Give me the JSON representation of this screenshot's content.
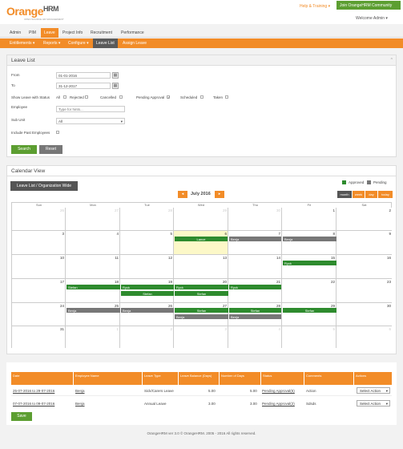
{
  "header": {
    "logo_prefix": "O",
    "logo_main": "range",
    "logo_hrm": "HRM",
    "logo_tagline": "OPEN SOURCE HR MANAGEMENT",
    "help_training": "Help & Training ▾",
    "join_community": "Join OrangeHRM Community",
    "welcome": "Welcome Admin ▾"
  },
  "main_menu": [
    "Admin",
    "PIM",
    "Leave",
    "Project Info",
    "Recruitment",
    "Performance"
  ],
  "sub_menu": [
    "Entitlements ▾",
    "Reports ▾",
    "Configure ▾",
    "Leave List",
    "Assign Leave"
  ],
  "leave_list": {
    "title": "Leave List",
    "from_label": "From",
    "from_value": "01-01-2016",
    "to_label": "To",
    "to_value": "31-12-2017",
    "status_label": "Show Leave with Status",
    "statuses": [
      {
        "label": "All",
        "checked": false
      },
      {
        "label": "Rejected",
        "checked": false
      },
      {
        "label": "Cancelled",
        "checked": false
      },
      {
        "label": "Pending Approval",
        "checked": true
      },
      {
        "label": "Scheduled",
        "checked": false
      },
      {
        "label": "Taken",
        "checked": false
      }
    ],
    "employee_label": "Employee",
    "employee_placeholder": "Type for hints...",
    "subunit_label": "Sub Unit",
    "subunit_value": "All",
    "past_label": "Include Past Employees",
    "search_btn": "Search",
    "reset_btn": "Reset"
  },
  "calendar": {
    "title": "Calendar View",
    "org_btn": "Leave List / Organization Wide",
    "legend_approved": "Approved",
    "legend_pending": "Pending",
    "month_label": "July 2016",
    "views": [
      "month",
      "week",
      "day",
      "today"
    ],
    "weekdays": [
      "Sun",
      "Mon",
      "Tue",
      "Wed",
      "Thu",
      "Fri",
      "Sat"
    ],
    "weeks": [
      [
        "26",
        "27",
        "28",
        "29",
        "30",
        "1",
        "2"
      ],
      [
        "3",
        "4",
        "5",
        "6",
        "7",
        "8",
        "9"
      ],
      [
        "10",
        "11",
        "12",
        "13",
        "14",
        "15",
        "16"
      ],
      [
        "17",
        "18",
        "19",
        "20",
        "21",
        "22",
        "23"
      ],
      [
        "24",
        "25",
        "26",
        "27",
        "28",
        "29",
        "30"
      ],
      [
        "31",
        "1",
        "2",
        "3",
        "4",
        "5",
        "6"
      ]
    ],
    "events": [
      {
        "label": "Lance",
        "color": "green"
      },
      {
        "label": "Benja",
        "color": "gray"
      },
      {
        "label": "Benja",
        "color": "gray"
      },
      {
        "label": "Ryck",
        "color": "green"
      },
      {
        "label": "Stefan",
        "color": "green"
      },
      {
        "label": "Ryck",
        "color": "green"
      },
      {
        "label": "Ryck",
        "color": "green"
      },
      {
        "label": "Ryck",
        "color": "green"
      },
      {
        "label": "Stefan",
        "color": "green"
      },
      {
        "label": "Stefan",
        "color": "green"
      },
      {
        "label": "Benja",
        "color": "gray"
      },
      {
        "label": "Benja",
        "color": "gray"
      },
      {
        "label": "Stefan",
        "color": "green"
      },
      {
        "label": "Stefan",
        "color": "green"
      },
      {
        "label": "Stefan",
        "color": "green"
      },
      {
        "label": "Benja",
        "color": "gray"
      },
      {
        "label": "Benja",
        "color": "gray"
      }
    ]
  },
  "table": {
    "headers": [
      "Date",
      "Employee Name",
      "Leave Type",
      "Leave Balance (Days)",
      "Number of Days",
      "Status",
      "Comments",
      "Actions"
    ],
    "rows": [
      {
        "date": "25-07-2016 to 29-07-2016",
        "employee": "Benja",
        "type": "Sick/Carers Leave",
        "balance": "5.00",
        "days": "5.00",
        "status": "Pending Approval(5)",
        "comments": "Action",
        "action": "Select Action"
      },
      {
        "date": "07-07-2016 to 09-07-2016",
        "employee": "Benja",
        "type": "Annual Leave",
        "balance": "3.00",
        "days": "3.00",
        "status": "Pending Approval(2)",
        "comments": "Sdsds",
        "action": "Select Action"
      }
    ],
    "save_btn": "Save"
  },
  "footer": "OrangeHRM ver 3.0 © OrangeHRM. 2005 - 2016 All rights reserved."
}
